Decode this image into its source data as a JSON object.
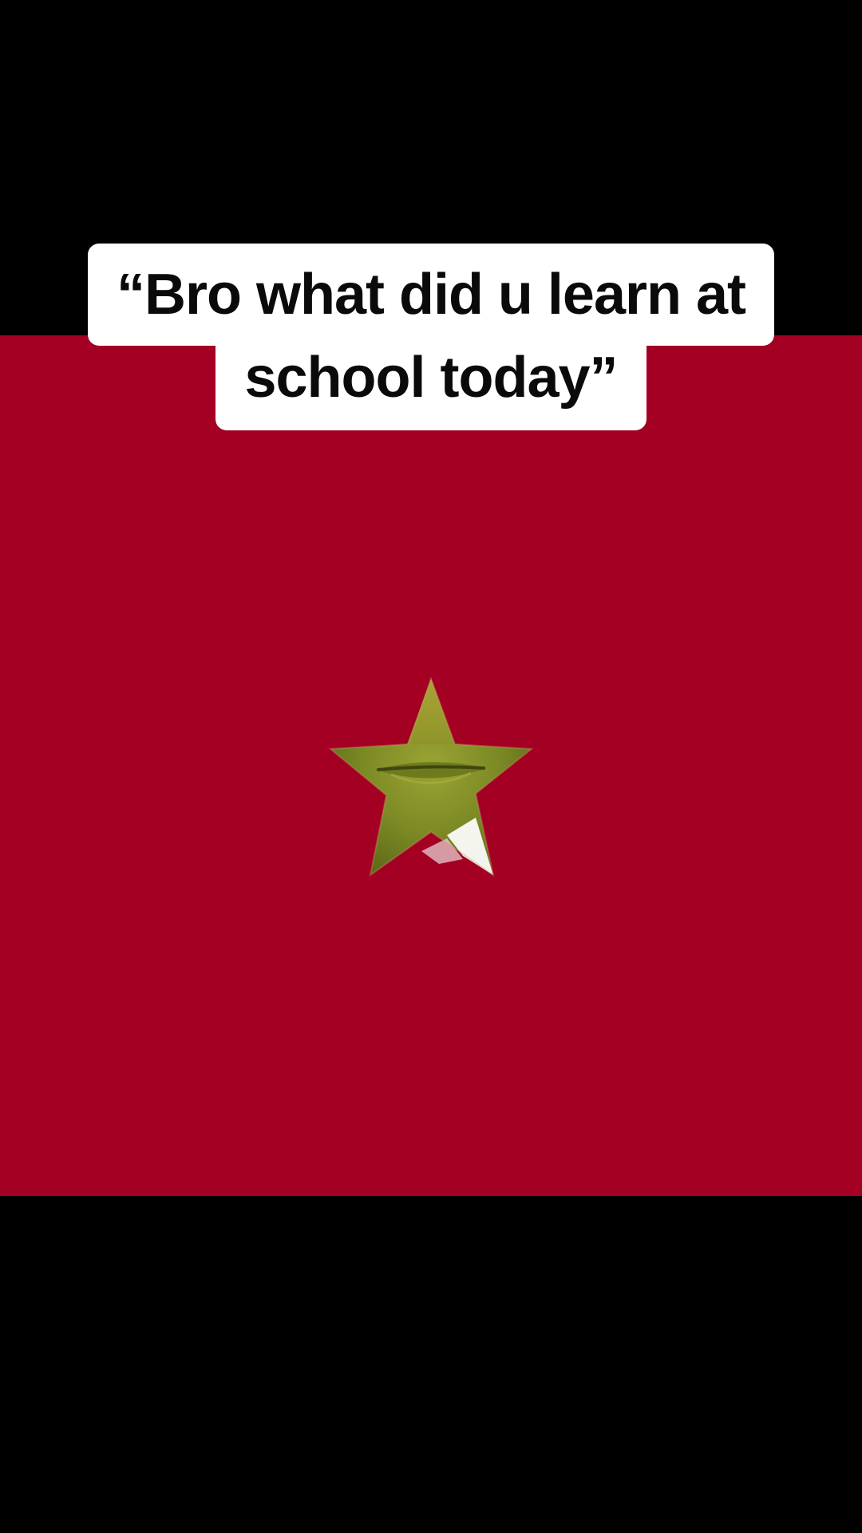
{
  "caption": {
    "line1": "“Bro what did u learn at",
    "line2": "school today”"
  },
  "colors": {
    "background": "#000000",
    "video_frame": "#a30023",
    "caption_bg": "#ffffff",
    "caption_text": "#0a0a0a",
    "star": "#8f9a28"
  },
  "media": {
    "icon": "smiling-star-icon"
  }
}
